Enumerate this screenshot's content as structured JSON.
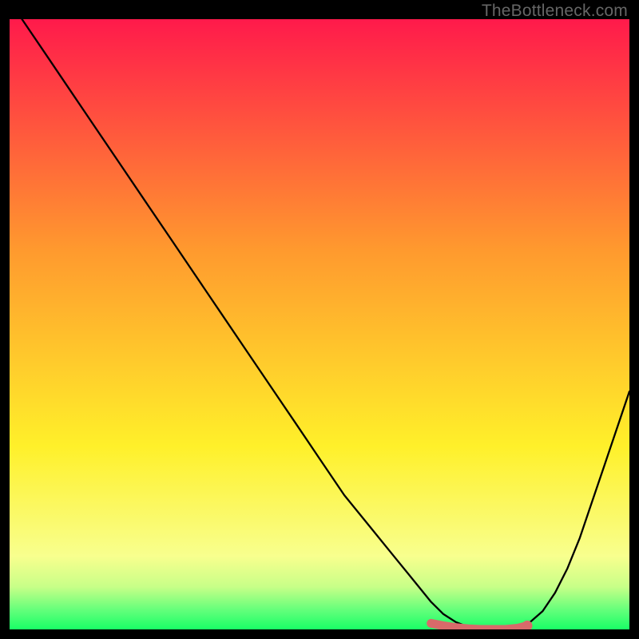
{
  "watermark": "TheBottleneck.com",
  "colors": {
    "gradient_top": "#ff1a4b",
    "gradient_mid1": "#ff7a2e",
    "gradient_mid2": "#fff02a",
    "gradient_mid3": "#f8ff6e",
    "gradient_bottom_band": "#a8f77a",
    "gradient_bottom": "#19ff66",
    "curve": "#000000",
    "marker": "#d86a6a"
  },
  "chart_data": {
    "type": "line",
    "title": "",
    "xlabel": "",
    "ylabel": "",
    "xlim": [
      0,
      100
    ],
    "ylim": [
      0,
      100
    ],
    "series": [
      {
        "name": "bottleneck-curve",
        "x": [
          2,
          6,
          10,
          14,
          18,
          22,
          26,
          30,
          34,
          38,
          42,
          46,
          50,
          54,
          58,
          62,
          66,
          68,
          70,
          72,
          74,
          76,
          78,
          80,
          82,
          84,
          86,
          88,
          90,
          92,
          94,
          96,
          98,
          100
        ],
        "y": [
          100,
          94,
          88,
          82,
          76,
          70,
          64,
          58,
          52,
          46,
          40,
          34,
          28,
          22,
          17,
          12,
          7,
          4.5,
          2.5,
          1.2,
          0.4,
          0,
          0,
          0,
          0.3,
          1.2,
          3,
          6,
          10,
          15,
          21,
          27,
          33,
          39
        ]
      },
      {
        "name": "optimal-band-marker",
        "x": [
          68,
          70,
          72,
          74,
          76,
          78,
          80,
          82,
          83.5
        ],
        "y": [
          1.0,
          0.6,
          0.3,
          0.1,
          0,
          0,
          0,
          0.2,
          0.6
        ]
      }
    ],
    "annotations": []
  }
}
